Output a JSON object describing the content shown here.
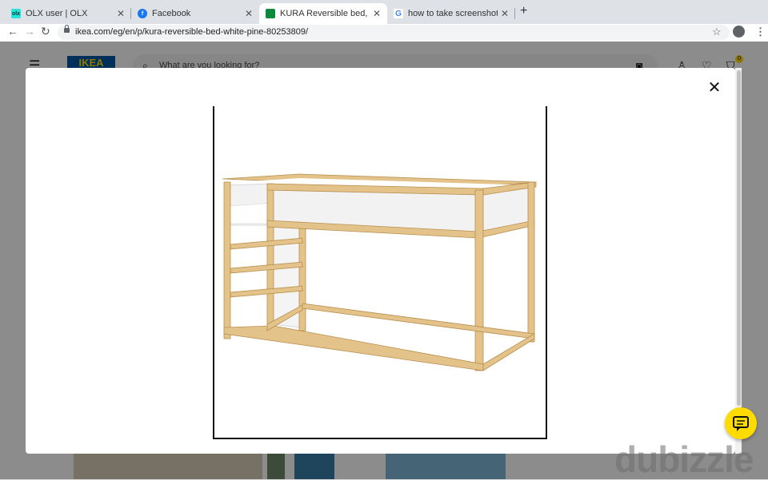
{
  "browser": {
    "tabs": [
      {
        "title": "OLX user | OLX",
        "favicon": "olx-icon",
        "active": false
      },
      {
        "title": "Facebook",
        "favicon": "facebook-icon",
        "active": false
      },
      {
        "title": "KURA Reversible bed, white/p",
        "favicon": "ikea-flag-icon",
        "active": true
      },
      {
        "title": "how to take screenshot on lap",
        "favicon": "google-icon",
        "active": false
      }
    ],
    "close_glyph": "✕",
    "new_tab_glyph": "+",
    "url": "ikea.com/eg/en/p/kura-reversible-bed-white-pine-80253809/"
  },
  "site": {
    "logo_text": "IKEA",
    "search_placeholder": "What are you looking for?",
    "cart_count": "0"
  },
  "modal": {
    "close_glyph": "✕",
    "image_alt": "KURA Reversible bed, white/pine"
  },
  "watermark": "dubizzle",
  "colors": {
    "ikea_blue": "#0058a3",
    "ikea_yellow": "#ffdb00",
    "pine": "#e3c38a",
    "panel_white": "#f2f2f2"
  }
}
